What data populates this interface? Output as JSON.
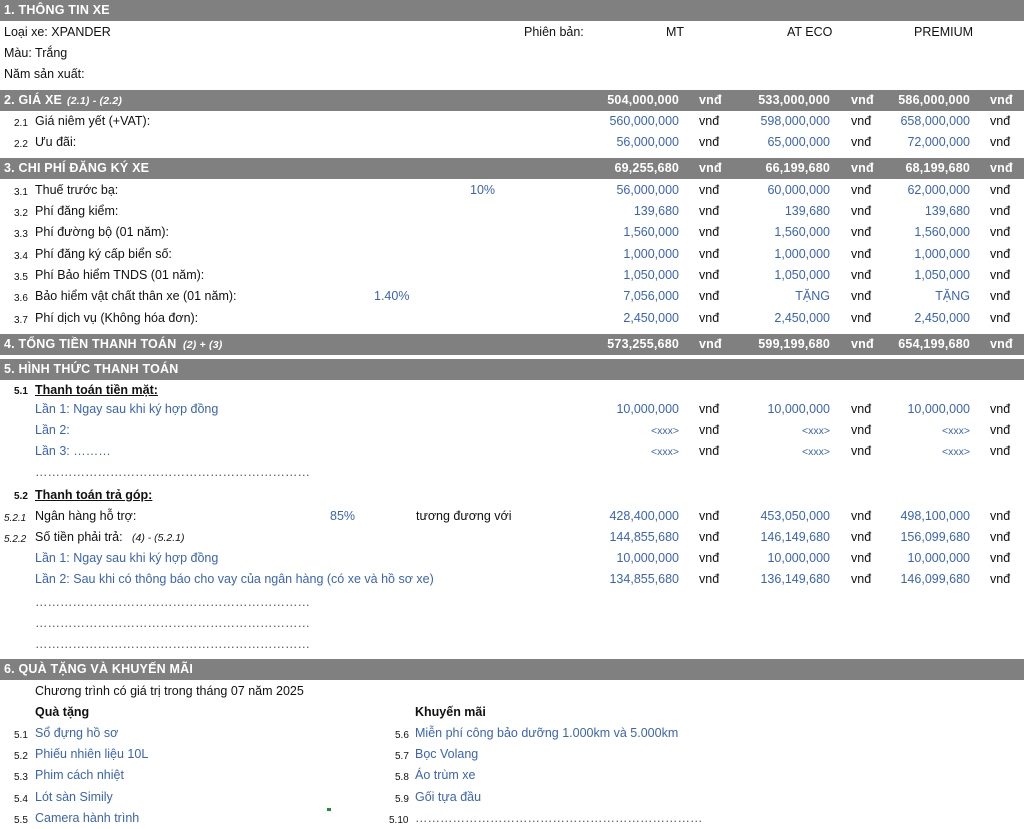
{
  "s1": {
    "title": "1. THÔNG TIN XE",
    "loai_xe": "Loại xe: XPANDER",
    "phien_ban": "Phiên bản:",
    "versions": [
      "MT",
      "AT ECO",
      "PREMIUM"
    ],
    "mau": "Màu: Trắng",
    "nam_sx": "Năm sản xuất:"
  },
  "currency": "vnđ",
  "s2": {
    "title": "2. GIÁ XE",
    "formula": "(2.1) - (2.2)",
    "totals": [
      "504,000,000",
      "533,000,000",
      "586,000,000"
    ],
    "rows": [
      {
        "num": "2.1",
        "label": "Giá niêm yết (+VAT):",
        "values": [
          "560,000,000",
          "598,000,000",
          "658,000,000"
        ]
      },
      {
        "num": "2.2",
        "label": "Ưu đãi:",
        "values": [
          "56,000,000",
          "65,000,000",
          "72,000,000"
        ]
      }
    ]
  },
  "s3": {
    "title": "3. CHI PHÍ ĐĂNG KÝ XE",
    "totals": [
      "69,255,680",
      "66,199,680",
      "68,199,680"
    ],
    "rows": [
      {
        "num": "3.1",
        "label": "Thuế trước bạ:",
        "rate": "10%",
        "values": [
          "56,000,000",
          "60,000,000",
          "62,000,000"
        ]
      },
      {
        "num": "3.2",
        "label": "Phí đăng kiểm:",
        "values": [
          "139,680",
          "139,680",
          "139,680"
        ]
      },
      {
        "num": "3.3",
        "label": "Phí đường bộ (01 năm):",
        "values": [
          "1,560,000",
          "1,560,000",
          "1,560,000"
        ]
      },
      {
        "num": "3.4",
        "label": "Phí đăng ký cấp biển số:",
        "values": [
          "1,000,000",
          "1,000,000",
          "1,000,000"
        ]
      },
      {
        "num": "3.5",
        "label": "Phí Bảo hiểm TNDS (01 năm):",
        "values": [
          "1,050,000",
          "1,050,000",
          "1,050,000"
        ]
      },
      {
        "num": "3.6",
        "label": "Bảo hiểm vật chất thân xe (01 năm):",
        "rate": "1.40%",
        "values": [
          "7,056,000",
          "TẶNG",
          "TẶNG"
        ]
      },
      {
        "num": "3.7",
        "label": "Phí dịch vụ (Không hóa đơn):",
        "values": [
          "2,450,000",
          "2,450,000",
          "2,450,000"
        ]
      }
    ]
  },
  "s4": {
    "title": "4. TỔNG TIỀN THANH TOÁN",
    "formula": "(2) + (3)",
    "totals": [
      "573,255,680",
      "599,199,680",
      "654,199,680"
    ]
  },
  "s5": {
    "title": "5. HÌNH THỨC THANH TOÁN",
    "cash_num": "5.1",
    "cash_title": "Thanh toán tiền mặt:",
    "cash_rows": [
      {
        "label": "Lần 1: Ngay sau khi ký hợp đồng",
        "values": [
          "10,000,000",
          "10,000,000",
          "10,000,000"
        ]
      },
      {
        "label": "Lần 2:",
        "values": [
          "<xxx>",
          "<xxx>",
          "<xxx>"
        ]
      },
      {
        "label": "Lần 3: ………",
        "values": [
          "<xxx>",
          "<xxx>",
          "<xxx>"
        ]
      }
    ],
    "dotted": "…………………………………………………………",
    "inst_num": "5.2",
    "inst_title": "Thanh toán trả góp:",
    "bank": {
      "num": "5.2.1",
      "label": "Ngân hàng hỗ trợ:",
      "rate": "85%",
      "equiv": "tương đương với",
      "values": [
        "428,400,000",
        "453,050,000",
        "498,100,000"
      ]
    },
    "pay": {
      "num": "5.2.2",
      "label": "Số tiền phải trả:",
      "formula": "(4) - (5.2.1)",
      "values": [
        "144,855,680",
        "146,149,680",
        "156,099,680"
      ]
    },
    "inst_rows": [
      {
        "label": "Lần 1: Ngay sau khi ký hợp đồng",
        "values": [
          "10,000,000",
          "10,000,000",
          "10,000,000"
        ]
      },
      {
        "label": "Lần 2: Sau khi có thông báo cho vay của ngân hàng (có xe và hồ sơ xe)",
        "values": [
          "134,855,680",
          "136,149,680",
          "146,099,680"
        ]
      }
    ]
  },
  "s6": {
    "title": "6. QUÀ TẶNG VÀ KHUYẾN MÃI",
    "note": "Chương trình có giá trị trong tháng 07 năm 2025",
    "gifts_title": "Quà tặng",
    "promos_title": "Khuyến mãi",
    "gifts": [
      {
        "num": "5.1",
        "label": "Sổ đựng hồ sơ"
      },
      {
        "num": "5.2",
        "label": "Phiếu nhiên liệu 10L"
      },
      {
        "num": "5.3",
        "label": "Phim cách nhiệt"
      },
      {
        "num": "5.4",
        "label": "Lót sàn Simily"
      },
      {
        "num": "5.5",
        "label": "Camera hành trình"
      }
    ],
    "promos": [
      {
        "num": "5.6",
        "label": "Miễn phí công bảo dưỡng 1.000km và 5.000km"
      },
      {
        "num": "5.7",
        "label": "Bọc Volang"
      },
      {
        "num": "5.8",
        "label": "Áo trùm xe"
      },
      {
        "num": "5.9",
        "label": "Gối tựa đầu"
      },
      {
        "num": "5.10",
        "label": "……………………………………………………………"
      }
    ]
  }
}
